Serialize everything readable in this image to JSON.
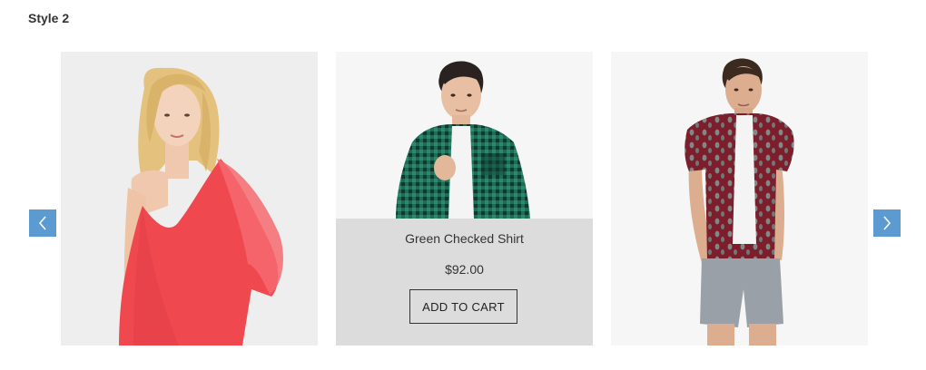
{
  "section": {
    "title": "Style 2"
  },
  "carousel": {
    "prev_icon": "chevron-left-icon",
    "next_icon": "chevron-right-icon",
    "nav_color": "#5b9bd1",
    "products": [
      {
        "image": "woman-red-dress"
      },
      {
        "image": "man-green-checked-shirt",
        "name": "Green Checked Shirt",
        "price": "$92.00",
        "cart_label": "ADD TO CART"
      },
      {
        "image": "man-burgundy-print-shirt"
      }
    ]
  }
}
